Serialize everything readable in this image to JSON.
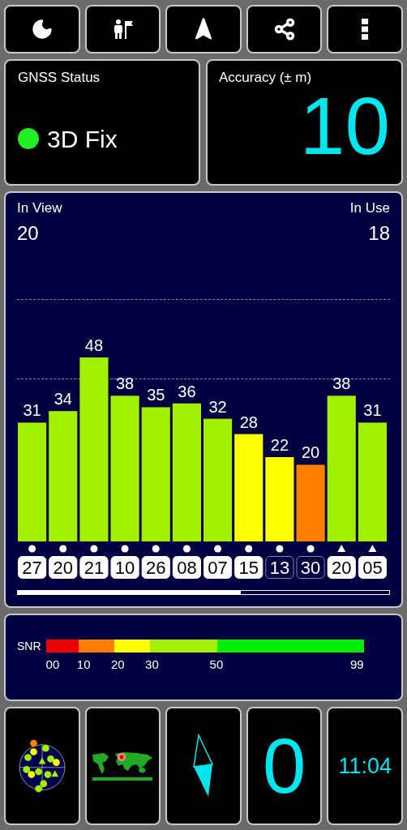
{
  "toolbar": [
    {
      "kind": "moon"
    },
    {
      "kind": "person-flag"
    },
    {
      "kind": "navigation"
    },
    {
      "kind": "share"
    },
    {
      "kind": "more"
    }
  ],
  "gnss_status": {
    "title": "GNSS Status",
    "value": "3D Fix",
    "color": "#22ee22"
  },
  "accuracy": {
    "title": "Accuracy (± m)",
    "value": "10"
  },
  "satellites_panel": {
    "in_view_label": "In View",
    "in_view": "20",
    "in_use_label": "In Use",
    "in_use": "18",
    "chart_data": {
      "type": "bar",
      "categories": [
        "27",
        "20",
        "21",
        "10",
        "26",
        "08",
        "07",
        "15",
        "13",
        "30",
        "20",
        "05"
      ],
      "values": [
        31,
        34,
        48,
        38,
        35,
        36,
        32,
        28,
        22,
        20,
        38,
        31
      ],
      "data_labels": true
    },
    "satellites": [
      {
        "kind": "dot",
        "in_use": true
      },
      {
        "kind": "dot",
        "in_use": true
      },
      {
        "kind": "dot",
        "in_use": true
      },
      {
        "kind": "dot",
        "in_use": true
      },
      {
        "kind": "dot",
        "in_use": true
      },
      {
        "kind": "dot",
        "in_use": true
      },
      {
        "kind": "dot",
        "in_use": true
      },
      {
        "kind": "dot",
        "in_use": true
      },
      {
        "kind": "dot",
        "in_use": false
      },
      {
        "kind": "dot",
        "in_use": false
      },
      {
        "kind": "triangle",
        "in_use": true
      },
      {
        "kind": "triangle",
        "in_use": true
      }
    ]
  },
  "snr_legend": {
    "label": "SNR",
    "segments": [
      {
        "color": "#ee0000"
      },
      {
        "color": "#ff8000"
      },
      {
        "color": "#ffff00"
      },
      {
        "color": "#a0f000"
      },
      {
        "color": "#00ee00"
      }
    ],
    "ticks": [
      "00",
      "10",
      "20",
      "30",
      "50",
      "99"
    ]
  },
  "bottom_tiles": [
    {
      "kind": "sky-plot"
    },
    {
      "kind": "world-map"
    },
    {
      "kind": "compass"
    },
    {
      "kind": "big-value",
      "value": "0"
    },
    {
      "kind": "clock",
      "value": "11:04"
    }
  ]
}
